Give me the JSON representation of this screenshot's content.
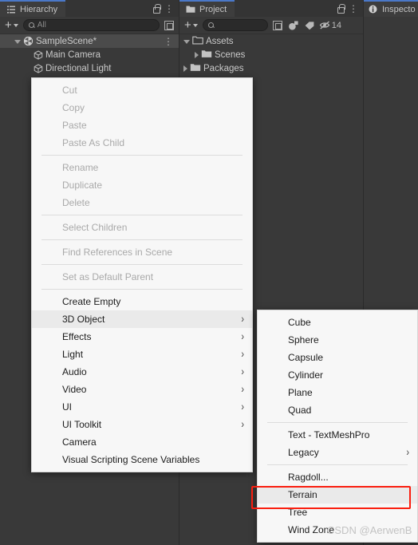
{
  "window": {
    "background": "#2b2b2b",
    "panel_bg": "#393939",
    "tab_bg": "#3d3d3d",
    "accent": "#4a78c8",
    "highlight_color": "#fa1e0f"
  },
  "hierarchy": {
    "tab_label": "Hierarchy",
    "tab_icon": "hierarchy-icon",
    "lock_icon": "lock-icon",
    "kebab_icon": "kebab-menu-icon",
    "toolbar": {
      "add_label": "+",
      "search_placeholder": "All",
      "search_value": "",
      "search_icon": "search-icon",
      "expand_icon": "expand-window-icon"
    },
    "tree": [
      {
        "label": "SampleScene*",
        "icon": "unity-scene-icon",
        "depth": 0,
        "expanded": true,
        "selected": true,
        "kebab": true
      },
      {
        "label": "Main Camera",
        "icon": "gameobject-cube-icon",
        "depth": 1,
        "expanded": null,
        "selected": false,
        "kebab": false
      },
      {
        "label": "Directional Light",
        "icon": "gameobject-cube-icon",
        "depth": 1,
        "expanded": null,
        "selected": false,
        "kebab": false
      }
    ]
  },
  "project": {
    "tab_label": "Project",
    "tab_icon": "folder-icon",
    "lock_icon": "lock-icon",
    "kebab_icon": "kebab-menu-icon",
    "toolbar": {
      "add_label": "+",
      "search_placeholder": "",
      "search_value": "",
      "search_icon": "search-icon",
      "expand_icon": "expand-window-icon",
      "filter_type_icon": "filter-by-type-icon",
      "filter_label_icon": "filter-by-label-icon",
      "hidden_packages_icon": "hidden-packages-icon",
      "hidden_packages_count": "14"
    },
    "tree": [
      {
        "label": "Assets",
        "icon": "folder-open-icon",
        "depth": 0,
        "expanded": true
      },
      {
        "label": "Scenes",
        "icon": "folder-icon",
        "depth": 1,
        "expanded": false
      },
      {
        "label": "Packages",
        "icon": "folder-icon",
        "depth": 0,
        "expanded": false
      }
    ]
  },
  "inspector": {
    "tab_label": "Inspecto",
    "tab_icon": "info-icon"
  },
  "context_menu": {
    "items": [
      {
        "label": "Cut",
        "disabled": true,
        "submenu": false,
        "highlighted": false
      },
      {
        "label": "Copy",
        "disabled": true,
        "submenu": false,
        "highlighted": false
      },
      {
        "label": "Paste",
        "disabled": true,
        "submenu": false,
        "highlighted": false
      },
      {
        "label": "Paste As Child",
        "disabled": true,
        "submenu": false,
        "highlighted": false
      },
      {
        "separator": true
      },
      {
        "label": "Rename",
        "disabled": true,
        "submenu": false,
        "highlighted": false
      },
      {
        "label": "Duplicate",
        "disabled": true,
        "submenu": false,
        "highlighted": false
      },
      {
        "label": "Delete",
        "disabled": true,
        "submenu": false,
        "highlighted": false
      },
      {
        "separator": true
      },
      {
        "label": "Select Children",
        "disabled": true,
        "submenu": false,
        "highlighted": false
      },
      {
        "separator": true
      },
      {
        "label": "Find References in Scene",
        "disabled": true,
        "submenu": false,
        "highlighted": false
      },
      {
        "separator": true
      },
      {
        "label": "Set as Default Parent",
        "disabled": true,
        "submenu": false,
        "highlighted": false
      },
      {
        "separator": true
      },
      {
        "label": "Create Empty",
        "disabled": false,
        "submenu": false,
        "highlighted": false
      },
      {
        "label": "3D Object",
        "disabled": false,
        "submenu": true,
        "highlighted": true
      },
      {
        "label": "Effects",
        "disabled": false,
        "submenu": true,
        "highlighted": false
      },
      {
        "label": "Light",
        "disabled": false,
        "submenu": true,
        "highlighted": false
      },
      {
        "label": "Audio",
        "disabled": false,
        "submenu": true,
        "highlighted": false
      },
      {
        "label": "Video",
        "disabled": false,
        "submenu": true,
        "highlighted": false
      },
      {
        "label": "UI",
        "disabled": false,
        "submenu": true,
        "highlighted": false
      },
      {
        "label": "UI Toolkit",
        "disabled": false,
        "submenu": true,
        "highlighted": false
      },
      {
        "label": "Camera",
        "disabled": false,
        "submenu": false,
        "highlighted": false
      },
      {
        "label": "Visual Scripting Scene Variables",
        "disabled": false,
        "submenu": false,
        "highlighted": false
      }
    ]
  },
  "submenu_3d_object": {
    "items": [
      {
        "label": "Cube",
        "disabled": false,
        "submenu": false,
        "highlighted": false
      },
      {
        "label": "Sphere",
        "disabled": false,
        "submenu": false,
        "highlighted": false
      },
      {
        "label": "Capsule",
        "disabled": false,
        "submenu": false,
        "highlighted": false
      },
      {
        "label": "Cylinder",
        "disabled": false,
        "submenu": false,
        "highlighted": false
      },
      {
        "label": "Plane",
        "disabled": false,
        "submenu": false,
        "highlighted": false
      },
      {
        "label": "Quad",
        "disabled": false,
        "submenu": false,
        "highlighted": false
      },
      {
        "separator": true
      },
      {
        "label": "Text - TextMeshPro",
        "disabled": false,
        "submenu": false,
        "highlighted": false
      },
      {
        "label": "Legacy",
        "disabled": false,
        "submenu": true,
        "highlighted": false
      },
      {
        "separator": true
      },
      {
        "label": "Ragdoll...",
        "disabled": false,
        "submenu": false,
        "highlighted": false
      },
      {
        "label": "Terrain",
        "disabled": false,
        "submenu": false,
        "highlighted": true
      },
      {
        "label": "Tree",
        "disabled": false,
        "submenu": false,
        "highlighted": false
      },
      {
        "label": "Wind Zone",
        "disabled": false,
        "submenu": false,
        "highlighted": false
      }
    ]
  },
  "annotation": {
    "target_label": "Terrain",
    "watermark": "CSDN @AerwenB"
  }
}
